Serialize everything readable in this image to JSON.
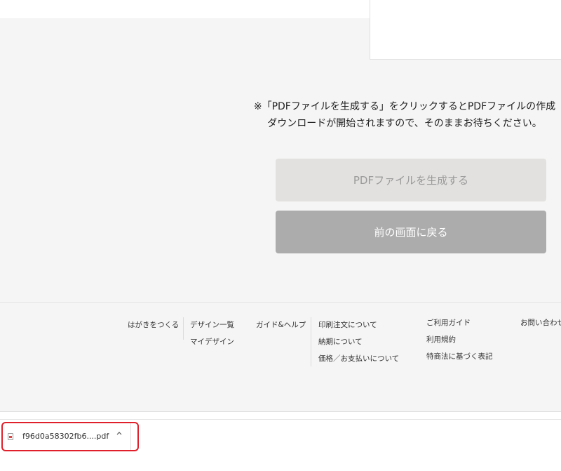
{
  "notice": {
    "line1": "※「PDFファイルを生成する」をクリックするとPDFファイルの作成",
    "line2": "ダウンロードが開始されますので、そのままお待ちください。"
  },
  "buttons": {
    "generate_label": "PDFファイルを生成する",
    "back_label": "前の画面に戻る"
  },
  "footer": {
    "col1": [
      "はがきをつくる"
    ],
    "col2": [
      "デザイン一覧",
      "マイデザイン"
    ],
    "col3": [
      "ガイド&ヘルプ"
    ],
    "col4": [
      "印刷注文について",
      "納期について",
      "価格／お支払いについて"
    ],
    "col5": [
      "ご利用ガイド",
      "利用規約",
      "特商法に基づく表記"
    ],
    "col6": [
      "お問い合わせ"
    ]
  },
  "download": {
    "filename": "f96d0a58302fb6....pdf",
    "menu_icon": "chevron-up-icon",
    "file_icon": "pdf-file-icon"
  },
  "colors": {
    "page_bg": "#f5f5f5",
    "button_disabled_bg": "#e2e1df",
    "button_back_bg": "#acacac",
    "highlight": "#e0202a"
  }
}
